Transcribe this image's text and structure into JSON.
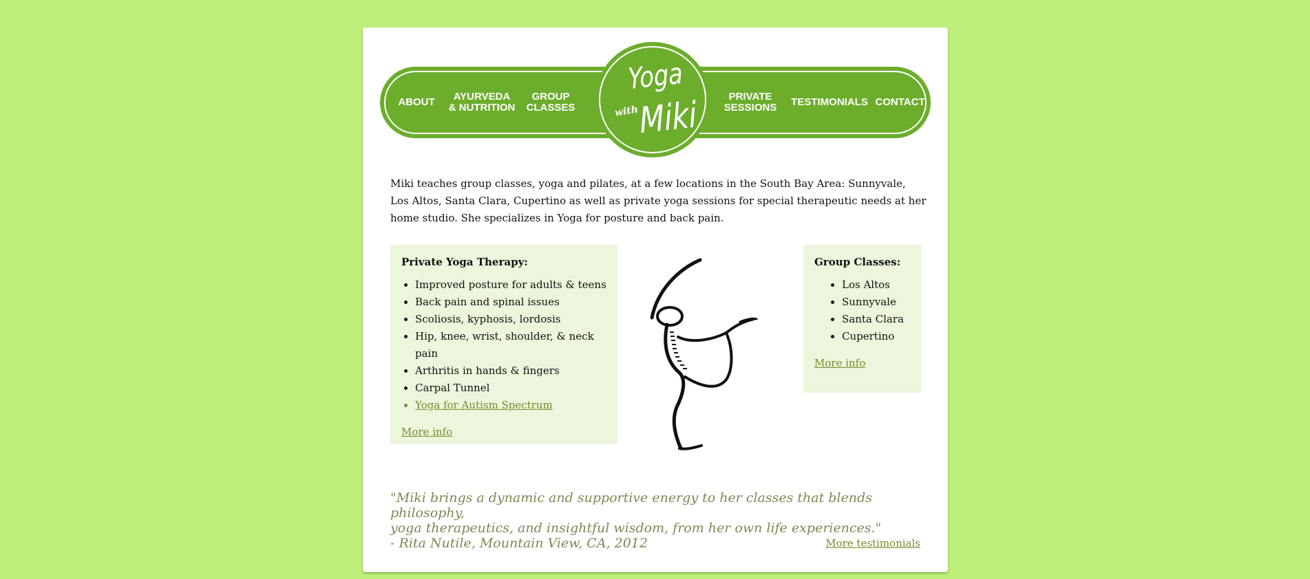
{
  "nav": {
    "left": [
      {
        "label": "ABOUT"
      },
      {
        "label": "AYURVEDA\n& NUTRITION"
      },
      {
        "label": "GROUP\nCLASSES"
      }
    ],
    "right": [
      {
        "label": "PRIVATE\nSESSIONS"
      },
      {
        "label": "TESTIMONIALS"
      },
      {
        "label": "CONTACT"
      }
    ]
  },
  "logo": {
    "line1": "Yoga",
    "with": "with",
    "line2": "Miki"
  },
  "intro": "Miki teaches group classes, yoga and pilates, at a few locations in the South Bay Area: Sunnyvale, Los Altos, Santa Clara, Cupertino as well as private yoga sessions for special therapeutic needs at her home studio. She specializes in Yoga for posture and back pain.",
  "private": {
    "title": "Private Yoga Therapy:",
    "items": [
      "Improved posture for adults & teens",
      "Back pain and spinal issues",
      "Scoliosis, kyphosis, lordosis",
      "Hip, knee, wrist, shoulder, & neck pain",
      "Arthritis in hands & fingers",
      "Carpal Tunnel"
    ],
    "link_item": "Yoga for Autism Spectrum",
    "more": "More info"
  },
  "group": {
    "title": "Group Classes:",
    "items": [
      "Los Altos",
      "Sunnyvale",
      "Santa Clara",
      "Cupertino"
    ],
    "more": "More info"
  },
  "quote": {
    "line1": "\"Miki brings a dynamic and supportive energy to her classes that blends philosophy,",
    "line2": "yoga therapeutics, and insightful wisdom, from her own life experiences.\"",
    "line3": "- Rita Nutile, Mountain View, CA, 2012"
  },
  "more_testimonials": "More testimonials",
  "colors": {
    "page_bg": "#bdef7a",
    "nav_green": "#6cad2c",
    "box_bg": "#ebf6dc",
    "link": "#7a8a2a",
    "quote": "#7a8a52"
  }
}
